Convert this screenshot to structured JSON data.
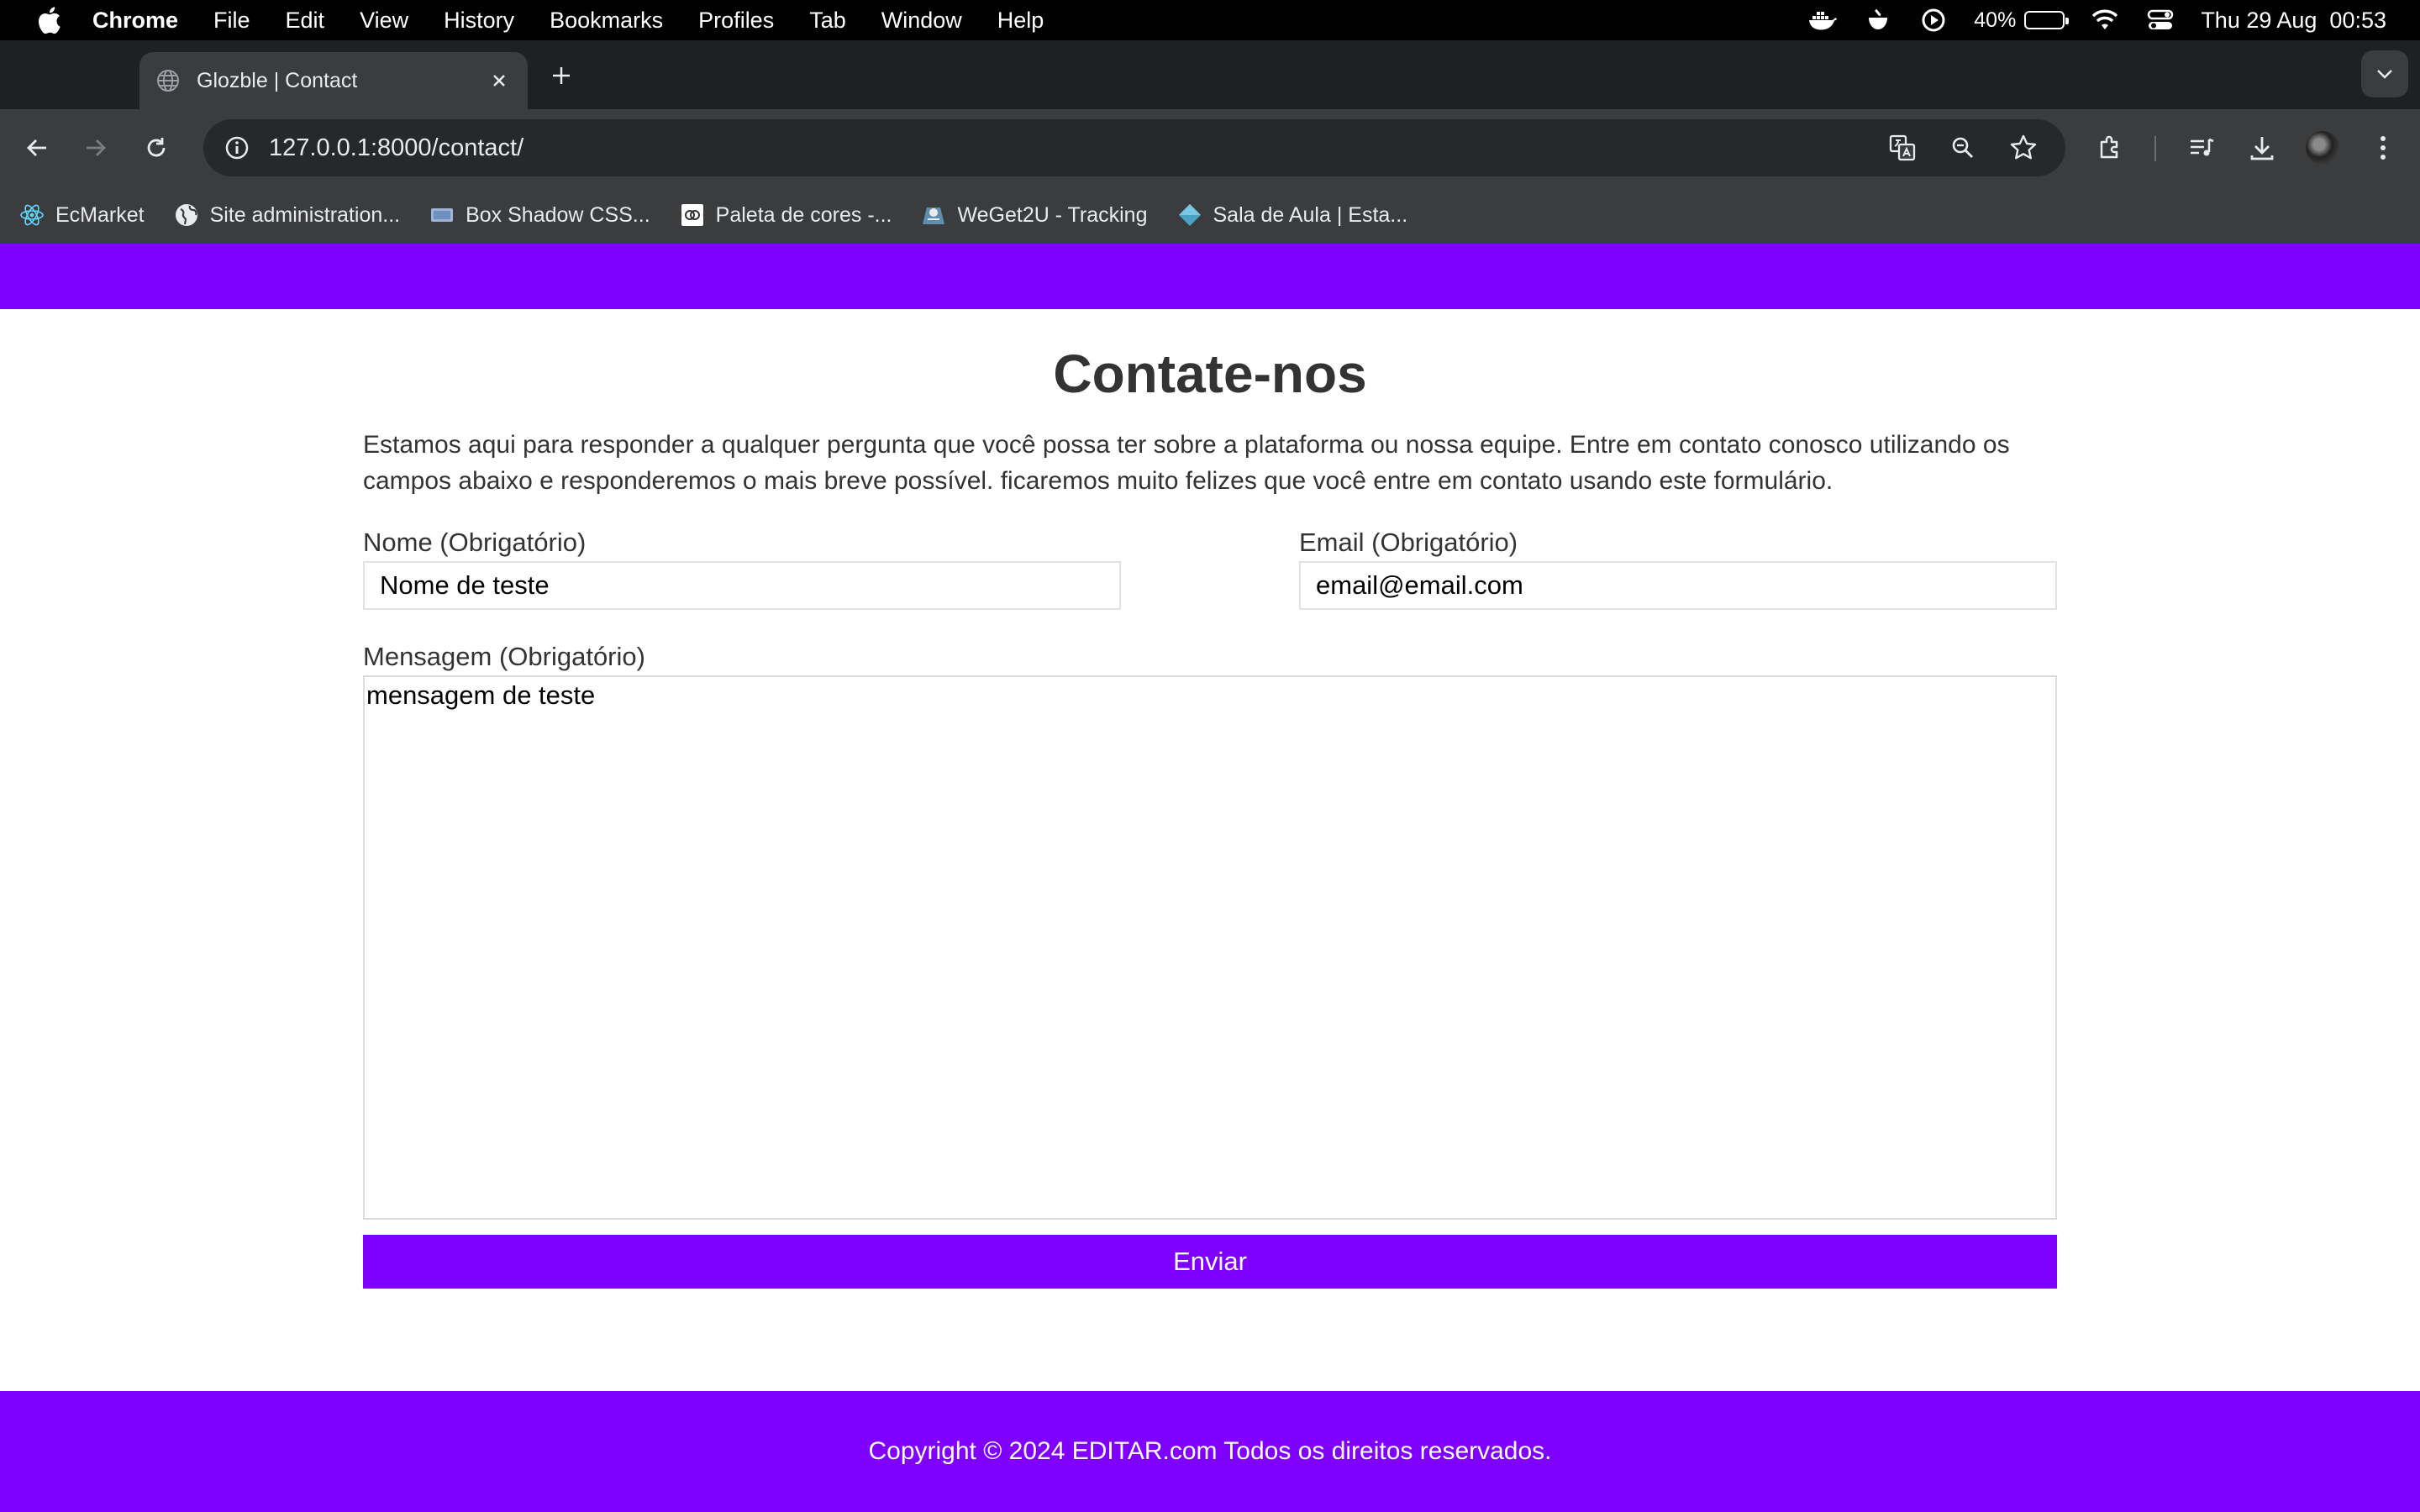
{
  "menubar": {
    "app_name": "Chrome",
    "items": [
      "File",
      "Edit",
      "View",
      "History",
      "Bookmarks",
      "Profiles",
      "Tab",
      "Window",
      "Help"
    ],
    "battery_percent": "40%",
    "battery_level": 0.4,
    "datetime": "Thu 29 Aug  00:53"
  },
  "browser": {
    "tab_title": "Glozble | Contact",
    "url": "127.0.0.1:8000/contact/",
    "bookmarks": [
      {
        "label": "EcMarket",
        "icon": "react-icon"
      },
      {
        "label": "Site administration...",
        "icon": "globe-icon"
      },
      {
        "label": "Box Shadow CSS...",
        "icon": "box-icon"
      },
      {
        "label": "Paleta de cores -...",
        "icon": "palette-icon"
      },
      {
        "label": "WeGet2U - Tracking",
        "icon": "tracking-icon"
      },
      {
        "label": "Sala de Aula | Esta...",
        "icon": "diamond-icon"
      }
    ]
  },
  "page": {
    "title": "Contate-nos",
    "intro": "Estamos aqui para responder a qualquer pergunta que você possa ter sobre a plataforma ou nossa equipe. Entre em contato conosco utilizando os campos abaixo e responderemos o mais breve possível. ficaremos muito felizes que você entre em contato usando este formulário.",
    "form": {
      "name_label": "Nome (Obrigatório)",
      "name_value": "Nome de teste",
      "email_label": "Email (Obrigatório)",
      "email_value": "email@email.com",
      "message_label": "Mensagem (Obrigatório)",
      "message_value": "mensagem de teste",
      "submit_label": "Enviar"
    },
    "footer": "Copyright © 2024 EDITAR.com Todos os direitos reservados."
  },
  "colors": {
    "brand": "#8000ff",
    "text": "#333333"
  }
}
